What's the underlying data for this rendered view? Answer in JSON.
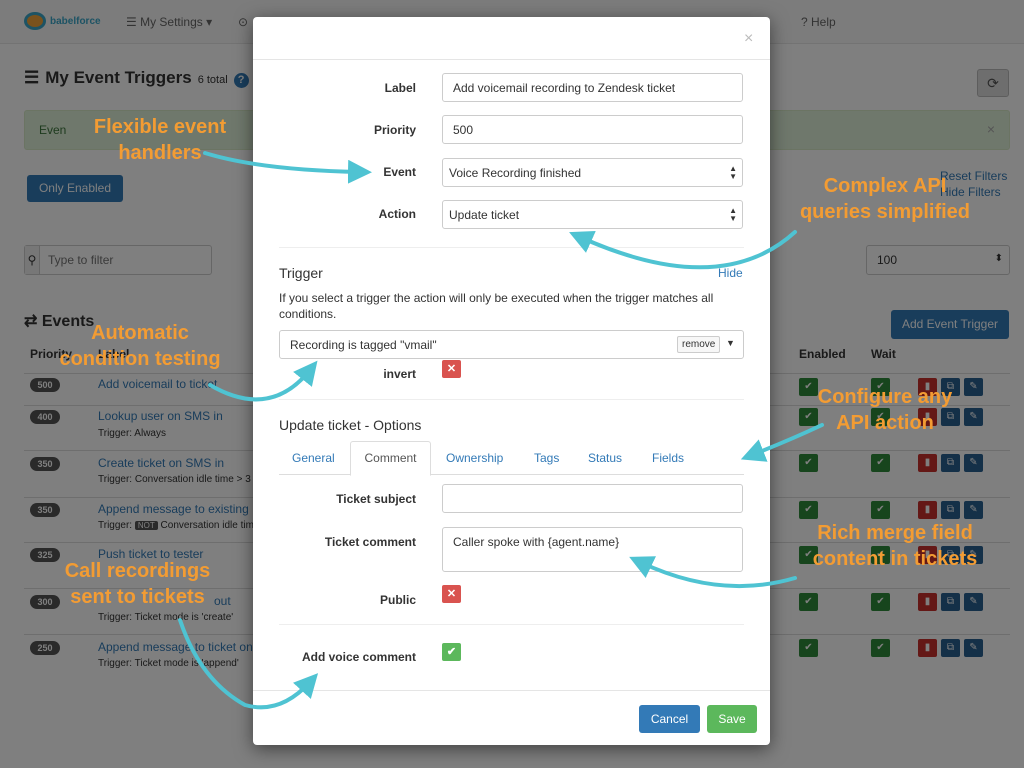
{
  "navbar": {
    "logo_text": "babelforce",
    "settings": "My Settings",
    "help": "Help"
  },
  "page": {
    "title": "My Event Triggers",
    "total": "6 total",
    "alert_text": "Even",
    "only_enabled": "Only Enabled",
    "reset_filters": "Reset Filters",
    "hide_filters": "Hide Filters",
    "filter_placeholder": "Type to filter",
    "page_size": "100",
    "events_title": "Events",
    "add_trigger": "Add Event Trigger",
    "columns": {
      "priority": "Priority",
      "label": "Label",
      "enabled": "Enabled",
      "wait": "Wait"
    },
    "rows": [
      {
        "priority": "500",
        "name": "Add voicemail to ticket",
        "trigger": ""
      },
      {
        "priority": "400",
        "name": "Lookup user on SMS in",
        "trigger": "Trigger: Always"
      },
      {
        "priority": "350",
        "name": "Create ticket on SMS in",
        "trigger": "Trigger: Conversation idle time > 3"
      },
      {
        "priority": "350",
        "name": "Append message to existing",
        "trigger": "Conversation idle time"
      },
      {
        "priority": "325",
        "name": "Push ticket to tester",
        "trigger": ""
      },
      {
        "priority": "300",
        "name": "out",
        "trigger": "Trigger: Ticket mode is 'create'"
      },
      {
        "priority": "250",
        "name": "Append message to ticket on",
        "trigger": "Trigger: Ticket mode is 'append'"
      }
    ],
    "not_label": "NOT"
  },
  "modal": {
    "close_icon": "×",
    "fields": {
      "label_label": "Label",
      "label_value": "Add voicemail recording to Zendesk ticket",
      "priority_label": "Priority",
      "priority_value": "500",
      "event_label": "Event",
      "event_value": "Voice Recording finished",
      "action_label": "Action",
      "action_value": "Update ticket"
    },
    "trigger": {
      "title": "Trigger",
      "hide": "Hide",
      "description": "If you select a trigger the action will only be executed when the trigger matches all conditions.",
      "condition": "Recording is tagged \"vmail\"",
      "remove": "remove",
      "invert_label": "invert"
    },
    "options": {
      "title": "Update ticket - Options",
      "tabs": [
        "General",
        "Comment",
        "Ownership",
        "Tags",
        "Status",
        "Fields"
      ],
      "ticket_subject_label": "Ticket subject",
      "ticket_subject_value": "",
      "ticket_comment_label": "Ticket comment",
      "ticket_comment_value": "Caller spoke with {agent.name}",
      "public_label": "Public",
      "add_voice_label": "Add voice comment"
    },
    "footer": {
      "cancel": "Cancel",
      "save": "Save"
    }
  },
  "annotations": {
    "flexible": "Flexible event\nhandlers",
    "complex": "Complex API\nqueries simplified",
    "automatic": "Automatic\ncondition testing",
    "configure": "Configure any\nAPI action",
    "rich": "Rich merge field\ncontent in tickets",
    "call": "Call recordings\nsent to tickets"
  },
  "colors": {
    "accent": "#337ab7",
    "annotation": "#f39c33",
    "arrow": "#4fc3d2",
    "save": "#5cb85c",
    "danger": "#d9534f"
  }
}
